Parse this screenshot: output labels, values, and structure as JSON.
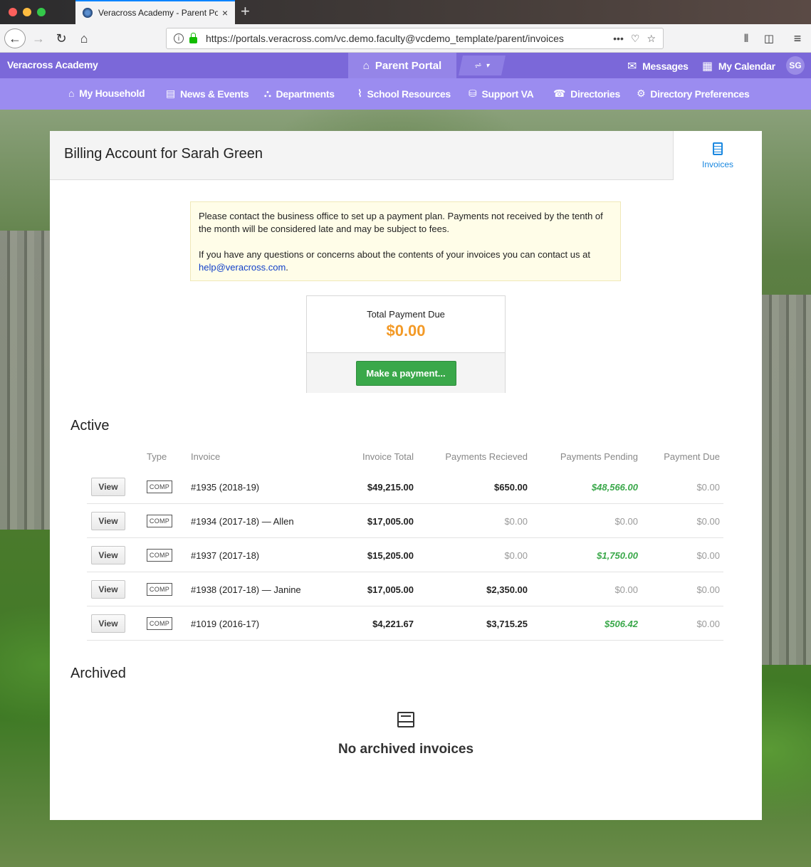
{
  "browser": {
    "tab_title": "Veracross Academy - Parent Po",
    "tab_close": "×",
    "new_tab": "+",
    "url": "https://portals.veracross.com/vc.demo.faculty@vcdemo_template/parent/invoices",
    "url_more": "•••"
  },
  "portal": {
    "brand": "Veracross Academy",
    "portal_name": "Parent Portal",
    "messages": "Messages",
    "calendar": "My Calendar",
    "avatar": "SG",
    "nav": [
      "My Household",
      "News & Events",
      "Departments",
      "School Resources",
      "Support VA",
      "Directories",
      "Directory Preferences"
    ]
  },
  "page": {
    "title": "Billing Account for Sarah Green",
    "side_tab": "Invoices",
    "notice_p1": "Please contact the business office to set up a payment plan. Payments not received by the tenth of the month will be considered late and may be subject to fees.",
    "notice_p2": "If you have any questions or concerns about the contents of your invoices you can contact us at",
    "notice_email": "help@veracross.com",
    "notice_end": ".",
    "total_label": "Total Payment Due",
    "total_amount": "$0.00",
    "pay_button": "Make a payment...",
    "active_heading": "Active",
    "archived_heading": "Archived",
    "empty_archived": "No archived invoices"
  },
  "table": {
    "headers": [
      "Type",
      "Invoice",
      "Invoice Total",
      "Payments Recieved",
      "Payments Pending",
      "Payment Due"
    ],
    "view_label": "View",
    "rows": [
      {
        "type": "COMP",
        "invoice": "#1935 (2018-19)",
        "total": "$49,215.00",
        "received": "$650.00",
        "pending": "$48,566.00",
        "due": "$0.00"
      },
      {
        "type": "COMP",
        "invoice": "#1934 (2017-18) — Allen",
        "total": "$17,005.00",
        "received": "$0.00",
        "pending": "$0.00",
        "due": "$0.00"
      },
      {
        "type": "COMP",
        "invoice": "#1937 (2017-18)",
        "total": "$15,205.00",
        "received": "$0.00",
        "pending": "$1,750.00",
        "due": "$0.00"
      },
      {
        "type": "COMP",
        "invoice": "#1938 (2017-18) — Janine",
        "total": "$17,005.00",
        "received": "$2,350.00",
        "pending": "$0.00",
        "due": "$0.00"
      },
      {
        "type": "COMP",
        "invoice": "#1019 (2016-17)",
        "total": "$4,221.67",
        "received": "$3,715.25",
        "pending": "$506.42",
        "due": "$0.00"
      }
    ]
  },
  "colors": {
    "portal_primary": "#7b68d9",
    "portal_nav": "#9b8cf0",
    "amount_orange": "#f39a27",
    "pay_green": "#3aa84a",
    "link_blue": "#1a88e0"
  }
}
